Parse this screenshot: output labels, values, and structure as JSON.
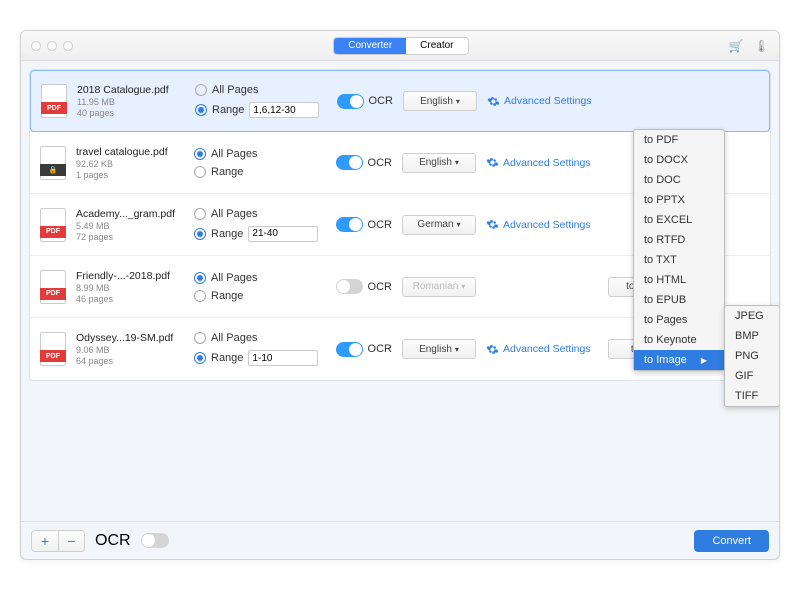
{
  "tabs": {
    "converter": "Converter",
    "creator": "Creator"
  },
  "labels": {
    "all_pages": "All Pages",
    "range": "Range",
    "ocr": "OCR",
    "advanced": "Advanced Settings",
    "convert": "Convert",
    "footer_ocr": "OCR"
  },
  "files": [
    {
      "name": "2018 Catalogue.pdf",
      "size": "11.95 MB",
      "pages": "40 pages",
      "icon": "pdf",
      "page_mode": "range",
      "range": "1,6,12-30",
      "ocr": true,
      "lang": "English",
      "adv": true,
      "format": null,
      "selected": true
    },
    {
      "name": "travel catalogue.pdf",
      "size": "92.62 KB",
      "pages": "1 pages",
      "icon": "lock",
      "page_mode": "all",
      "range": "",
      "ocr": true,
      "lang": "English",
      "adv": true,
      "format": null
    },
    {
      "name": "Academy..._gram.pdf",
      "size": "5.49 MB",
      "pages": "72 pages",
      "icon": "pdf",
      "page_mode": "range",
      "range": "21-40",
      "ocr": true,
      "lang": "German",
      "adv": true,
      "format": null,
      "locked": true
    },
    {
      "name": "Friendly-...-2018.pdf",
      "size": "8.99 MB",
      "pages": "46 pages",
      "icon": "pdf",
      "page_mode": "all",
      "range": "",
      "ocr": false,
      "lang": "Romanian",
      "adv": false,
      "format": "to Keynote"
    },
    {
      "name": "Odyssey...19-SM.pdf",
      "size": "9.06 MB",
      "pages": "64 pages",
      "icon": "pdf",
      "page_mode": "range",
      "range": "1-10",
      "ocr": true,
      "lang": "English",
      "adv": true,
      "format": "to EPUB"
    }
  ],
  "format_menu": [
    "to PDF",
    "to DOCX",
    "to DOC",
    "to PPTX",
    "to EXCEL",
    "to RTFD",
    "to TXT",
    "to HTML",
    "to EPUB",
    "to Pages",
    "to Keynote",
    "to Image"
  ],
  "format_menu_highlight": "to Image",
  "image_submenu": [
    "JPEG",
    "BMP",
    "PNG",
    "GIF",
    "TIFF"
  ],
  "icons": {
    "pdf_label": "PDF"
  }
}
